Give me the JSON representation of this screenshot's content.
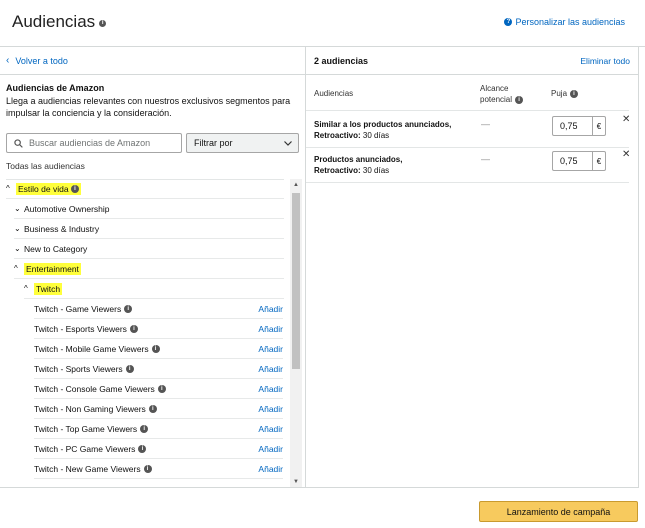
{
  "header": {
    "title": "Audiencias",
    "customize_link": "Personalizar las audiencias"
  },
  "left": {
    "back_label": "Volver a todo",
    "amazon_title": "Audiencias de Amazon",
    "amazon_desc": "Llega a audiencias relevantes con nuestros exclusivos segmentos para impulsar la conciencia y la consideración.",
    "search_placeholder": "Buscar audiencias de Amazon",
    "filter_label": "Filtrar por",
    "all_label": "Todas las audiencias",
    "tree": {
      "cat_lifestyle": "Estilo de vida",
      "automotive": "Automotive Ownership",
      "business": "Business & Industry",
      "new_category": "New to Category",
      "entertainment": "Entertainment",
      "twitch": "Twitch",
      "add_label": "Añadir",
      "leaves": [
        "Twitch - Game Viewers",
        "Twitch - Esports Viewers",
        "Twitch - Mobile Game Viewers",
        "Twitch - Sports Viewers",
        "Twitch - Console Game Viewers",
        "Twitch - Non Gaming Viewers",
        "Twitch - Top Game Viewers",
        "Twitch - PC Game Viewers",
        "Twitch - New Game Viewers"
      ]
    }
  },
  "right": {
    "count": "2 audiencias",
    "remove_all": "Eliminar todo",
    "col_audiences": "Audiencias",
    "col_reach_1": "Alcance",
    "col_reach_2": "potencial",
    "col_bid": "Puja",
    "rows": [
      {
        "name": "Similar a los productos anunciados,",
        "lookback_label": "Retroactivo:",
        "lookback_value": "30 días",
        "reach": "—",
        "bid": "0,75",
        "currency": "€"
      },
      {
        "name": "Productos anunciados,",
        "lookback_label": "Retroactivo:",
        "lookback_value": "30 días",
        "reach": "—",
        "bid": "0,75",
        "currency": "€"
      }
    ]
  },
  "footer": {
    "launch_label": "Lanzamiento de campaña"
  },
  "colors": {
    "link": "#0066c0",
    "highlight": "#ffff3b",
    "button": "#f7ca5e"
  }
}
